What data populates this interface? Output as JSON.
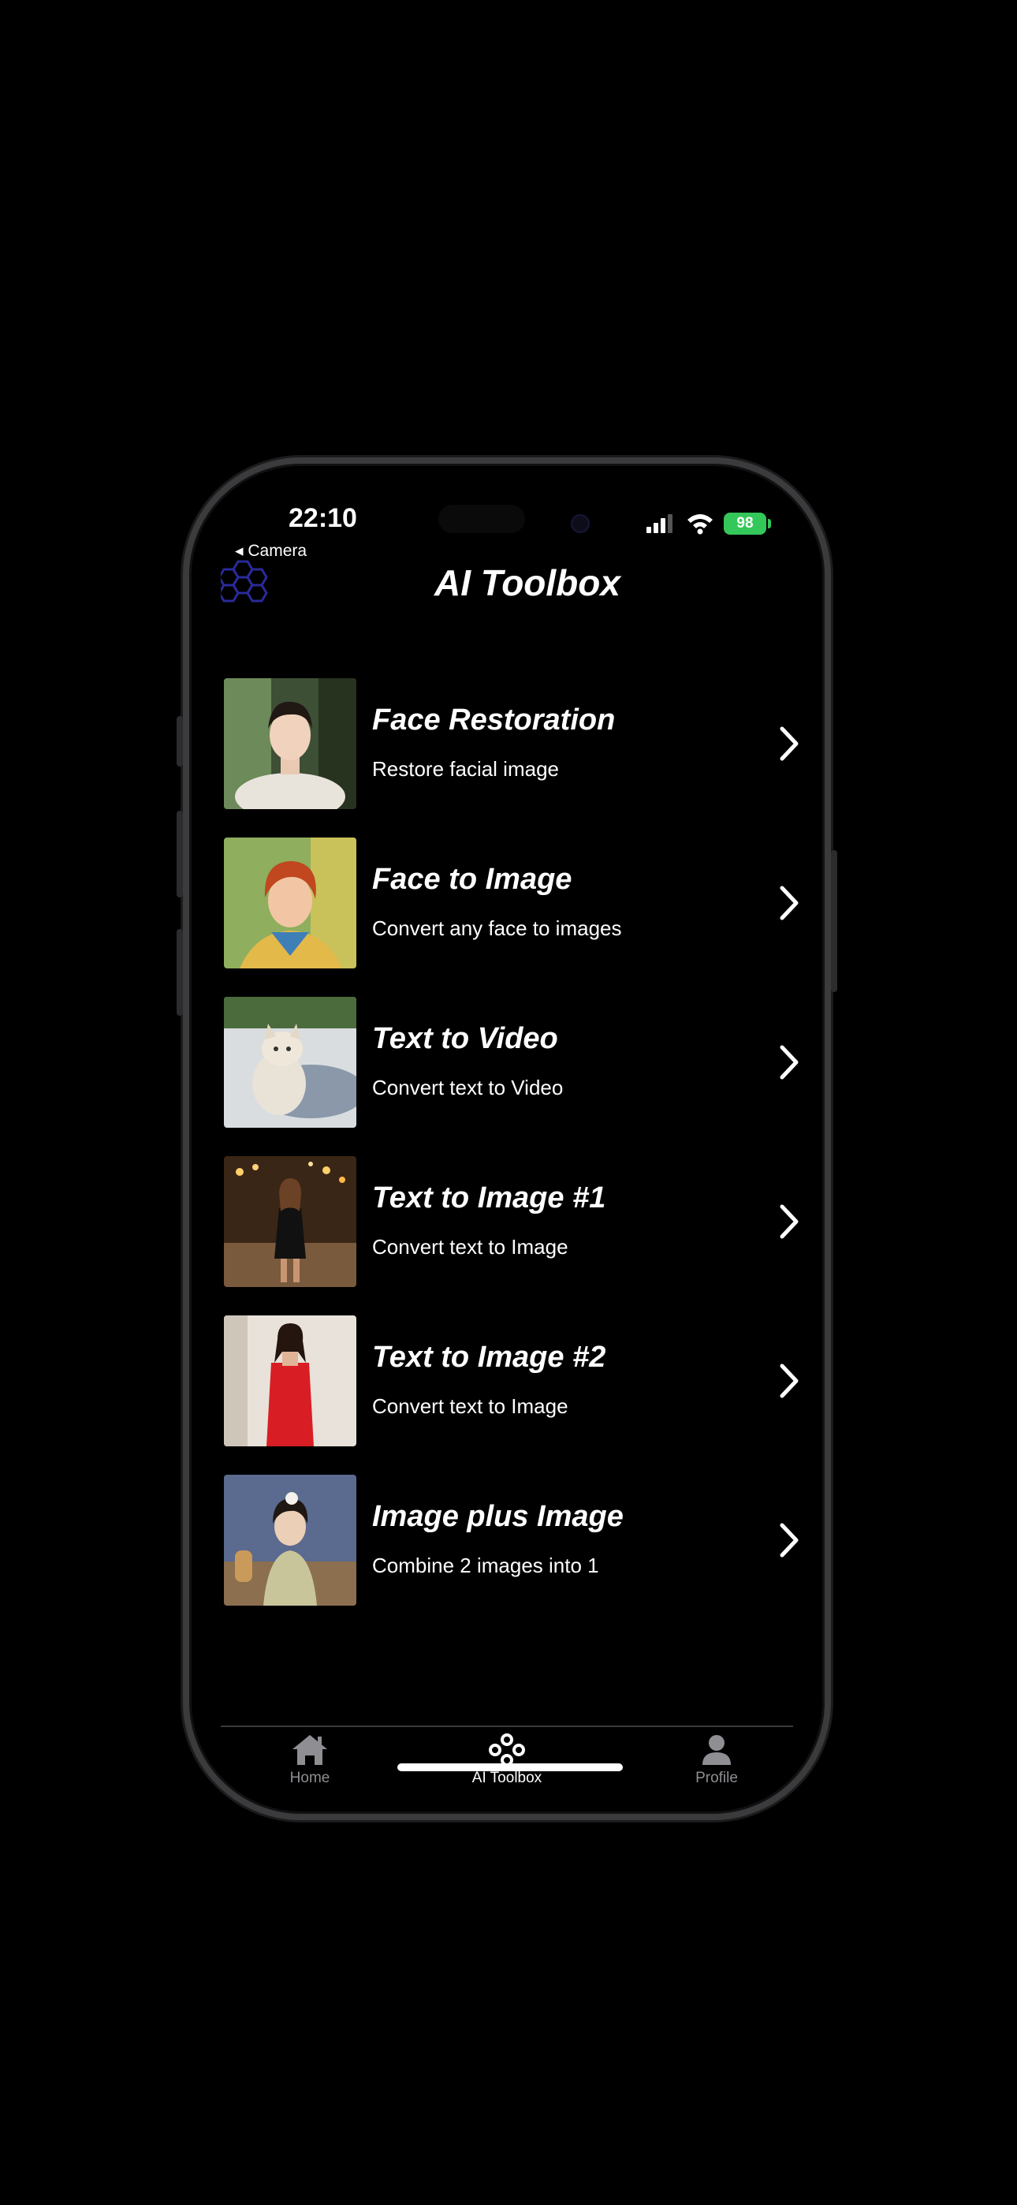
{
  "status": {
    "time": "22:10",
    "back_label": "◂ Camera",
    "battery": "98"
  },
  "header": {
    "title": "AI Toolbox"
  },
  "tools": [
    {
      "title": "Face Restoration",
      "subtitle": "Restore facial image"
    },
    {
      "title": "Face to Image",
      "subtitle": "Convert any face to images"
    },
    {
      "title": "Text to Video",
      "subtitle": "Convert text to Video"
    },
    {
      "title": "Text to Image #1",
      "subtitle": "Convert text to Image"
    },
    {
      "title": "Text to Image #2",
      "subtitle": "Convert text to Image"
    },
    {
      "title": "Image plus Image",
      "subtitle": "Combine 2 images into 1"
    }
  ],
  "tabbar": {
    "home": "Home",
    "toolbox": "AI Toolbox",
    "profile": "Profile"
  },
  "colors": {
    "background": "#000000",
    "active_tab": "#ffffff",
    "inactive_tab": "#8e8e93",
    "battery": "#34c759"
  }
}
